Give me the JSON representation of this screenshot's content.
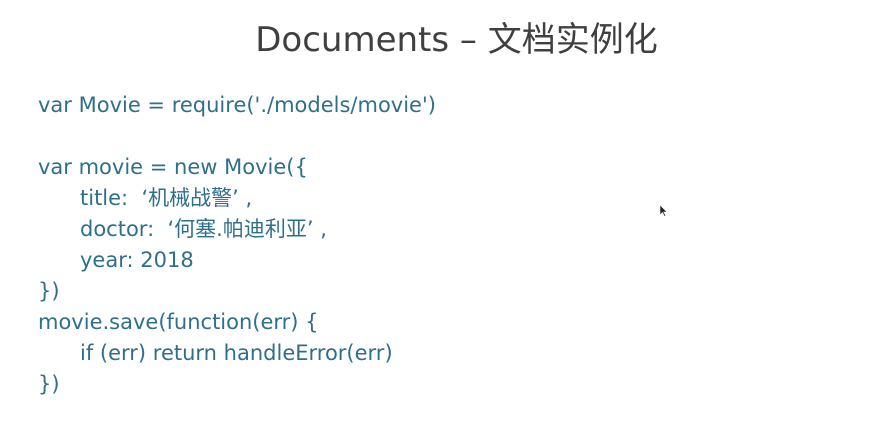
{
  "slide": {
    "title": "Documents – 文档实例化",
    "code_lines": [
      "var Movie = require('./models/movie')",
      "",
      "var movie = new Movie({",
      "title:  ‘机械战警’ ,",
      "doctor:  ‘何塞.帕迪利亚’ ,",
      "year: 2018",
      "})",
      "movie.save(function(err) {",
      "if (err) return handleError(err)",
      "})"
    ]
  },
  "colors": {
    "title": "#3f3f3f",
    "code": "#2f6f8c",
    "background": "#ffffff"
  }
}
